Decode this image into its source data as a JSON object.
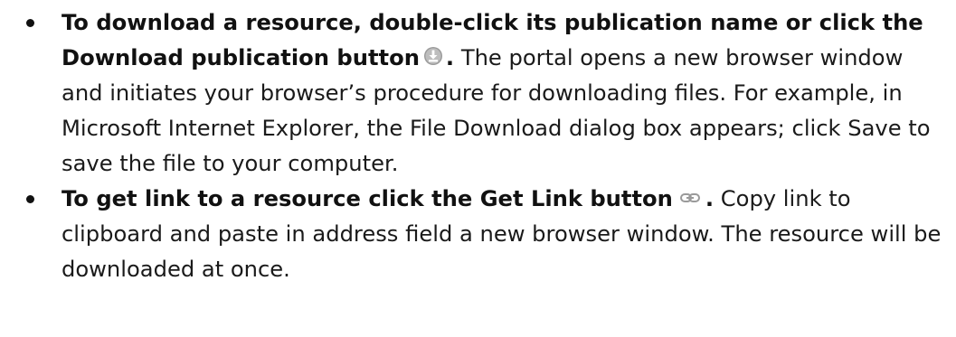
{
  "bullets": [
    {
      "lead_before_icon": "To download a resource, double-click its publication name or click the Download publication button",
      "lead_after_icon": ".",
      "icon": "download-circle-icon",
      "body": " The portal opens a new browser window and initiates your browser’s procedure for downloading files. For example, in Microsoft Internet Explorer, the File Download dialog box appears; click Save to save the file to your computer."
    },
    {
      "lead_before_icon": "To get link to a resource click the Get Link button",
      "lead_after_icon": ".",
      "icon": "chain-link-icon",
      "body": " Copy link to clipboard and paste in address field a new browser window. The resource will be downloaded at once."
    }
  ],
  "colors": {
    "text": "#1a1a1a",
    "icon_gray": "#9a9a9a"
  }
}
